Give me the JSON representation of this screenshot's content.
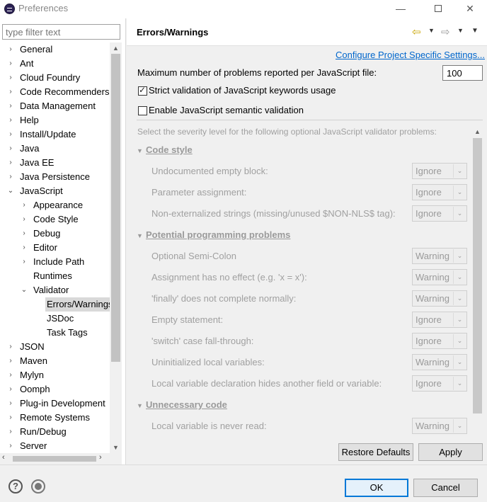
{
  "window": {
    "title": "Preferences",
    "minimize": "—",
    "close": "✕"
  },
  "sidebar": {
    "filter_placeholder": "type filter text",
    "items": [
      {
        "label": "General",
        "depth": 0,
        "arrow": "›"
      },
      {
        "label": "Ant",
        "depth": 0,
        "arrow": "›"
      },
      {
        "label": "Cloud Foundry",
        "depth": 0,
        "arrow": "›"
      },
      {
        "label": "Code Recommenders",
        "depth": 0,
        "arrow": "›"
      },
      {
        "label": "Data Management",
        "depth": 0,
        "arrow": "›"
      },
      {
        "label": "Help",
        "depth": 0,
        "arrow": "›"
      },
      {
        "label": "Install/Update",
        "depth": 0,
        "arrow": "›"
      },
      {
        "label": "Java",
        "depth": 0,
        "arrow": "›"
      },
      {
        "label": "Java EE",
        "depth": 0,
        "arrow": "›"
      },
      {
        "label": "Java Persistence",
        "depth": 0,
        "arrow": "›"
      },
      {
        "label": "JavaScript",
        "depth": 0,
        "arrow": "⌄"
      },
      {
        "label": "Appearance",
        "depth": 1,
        "arrow": "›"
      },
      {
        "label": "Code Style",
        "depth": 1,
        "arrow": "›"
      },
      {
        "label": "Debug",
        "depth": 1,
        "arrow": "›"
      },
      {
        "label": "Editor",
        "depth": 1,
        "arrow": "›"
      },
      {
        "label": "Include Path",
        "depth": 1,
        "arrow": "›"
      },
      {
        "label": "Runtimes",
        "depth": 1,
        "arrow": ""
      },
      {
        "label": "Validator",
        "depth": 1,
        "arrow": "⌄"
      },
      {
        "label": "Errors/Warnings",
        "depth": 2,
        "arrow": "",
        "selected": true
      },
      {
        "label": "JSDoc",
        "depth": 2,
        "arrow": ""
      },
      {
        "label": "Task Tags",
        "depth": 2,
        "arrow": ""
      },
      {
        "label": "JSON",
        "depth": 0,
        "arrow": "›"
      },
      {
        "label": "Maven",
        "depth": 0,
        "arrow": "›"
      },
      {
        "label": "Mylyn",
        "depth": 0,
        "arrow": "›"
      },
      {
        "label": "Oomph",
        "depth": 0,
        "arrow": "›"
      },
      {
        "label": "Plug-in Development",
        "depth": 0,
        "arrow": "›"
      },
      {
        "label": "Remote Systems",
        "depth": 0,
        "arrow": "›"
      },
      {
        "label": "Run/Debug",
        "depth": 0,
        "arrow": "›"
      },
      {
        "label": "Server",
        "depth": 0,
        "arrow": "›"
      }
    ]
  },
  "page": {
    "title": "Errors/Warnings",
    "configure_link": "Configure Project Specific Settings...",
    "max_problems_label": "Maximum number of problems reported per JavaScript file:",
    "max_problems_value": "100",
    "strict_label": "Strict validation of JavaScript keywords usage",
    "strict_checked": true,
    "semantic_label": "Enable JavaScript semantic validation",
    "semantic_checked": false,
    "hint": "Select the severity level for the following optional JavaScript validator problems:",
    "sections": [
      {
        "title": "Code style",
        "options": [
          {
            "label": "Undocumented empty block:",
            "value": "Ignore"
          },
          {
            "label": "Parameter assignment:",
            "value": "Ignore"
          },
          {
            "label": "Non-externalized strings (missing/unused $NON-NLS$ tag):",
            "value": "Ignore"
          }
        ]
      },
      {
        "title": "Potential programming problems",
        "options": [
          {
            "label": "Optional Semi-Colon",
            "value": "Warning"
          },
          {
            "label": "Assignment has no effect (e.g. 'x = x'):",
            "value": "Warning"
          },
          {
            "label": "'finally' does not complete normally:",
            "value": "Warning"
          },
          {
            "label": "Empty statement:",
            "value": "Ignore"
          },
          {
            "label": "'switch' case fall-through:",
            "value": "Ignore"
          },
          {
            "label": "Uninitialized local variables:",
            "value": "Warning"
          },
          {
            "label": "Local variable declaration hides another field or variable:",
            "value": "Ignore"
          }
        ]
      },
      {
        "title": "Unnecessary code",
        "options": [
          {
            "label": "Local variable is never read:",
            "value": "Warning"
          }
        ]
      }
    ],
    "restore_defaults": "Restore Defaults",
    "apply": "Apply"
  },
  "footer": {
    "help": "?",
    "ok": "OK",
    "cancel": "Cancel"
  }
}
